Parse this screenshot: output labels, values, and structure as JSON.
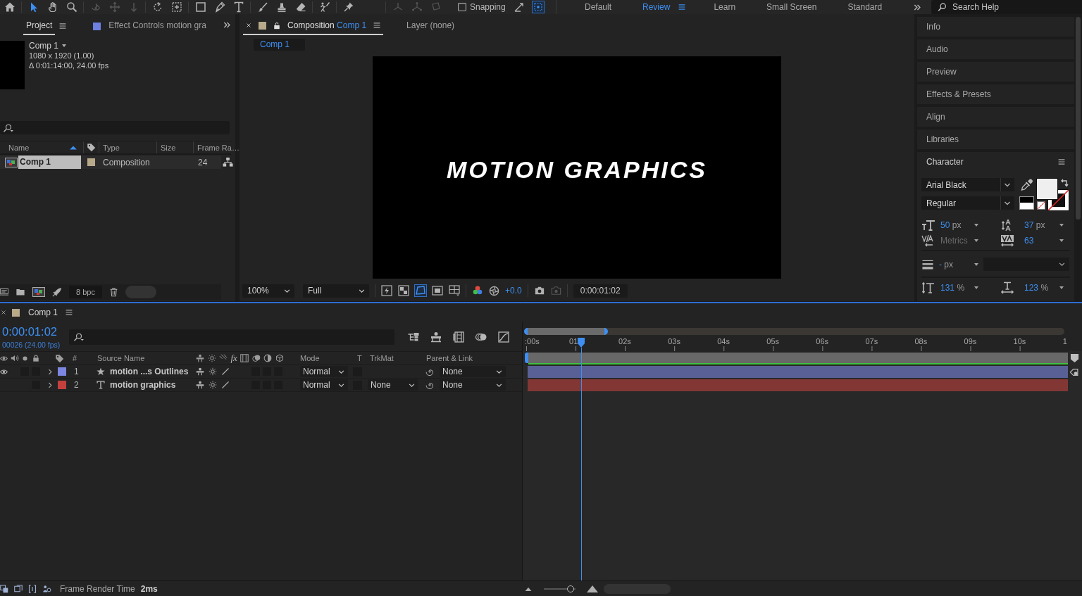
{
  "toolbar": {
    "tools": [
      {
        "selected": true,
        "disabled": false
      },
      {
        "selected": false,
        "disabled": false
      },
      {
        "selected": false,
        "disabled": false
      },
      {
        "selected": false,
        "disabled": true
      },
      {
        "selected": false,
        "disabled": true
      },
      {
        "selected": false,
        "disabled": true
      },
      {
        "selected": false,
        "disabled": false
      },
      {
        "selected": false,
        "disabled": false
      },
      {
        "selected": false,
        "disabled": false
      },
      {
        "selected": false,
        "disabled": false
      },
      {
        "selected": false,
        "disabled": false
      },
      {
        "selected": false,
        "disabled": false
      },
      {
        "selected": false,
        "disabled": false
      },
      {
        "selected": false,
        "disabled": false
      },
      {
        "selected": false,
        "disabled": false
      },
      {
        "selected": false,
        "disabled": false
      }
    ],
    "axis_modes": [
      {
        "disabled": true
      },
      {
        "disabled": true
      },
      {
        "disabled": true
      }
    ],
    "snapping": {
      "label": "Snapping",
      "checked": false
    },
    "snap_options": [
      {
        "on": false
      },
      {
        "on": true
      }
    ],
    "workspaces": [
      {
        "label": "Default",
        "selected": false
      },
      {
        "label": "Review",
        "selected": true
      },
      {
        "label": "Learn",
        "selected": false
      },
      {
        "label": "Small Screen",
        "selected": false
      },
      {
        "label": "Standard",
        "selected": false
      }
    ],
    "search": {
      "placeholder": "Search Help"
    }
  },
  "project_panel": {
    "tabs": [
      {
        "label": "Project",
        "selected": true
      },
      {
        "label": "Effect Controls motion gra",
        "selected": false,
        "color": "#6e80e0"
      }
    ],
    "preview": {
      "name": "Comp 1",
      "details": [
        "1080 x 1920 (1.00)",
        "Δ 0:01:14:00, 24.00 fps"
      ]
    },
    "columns": [
      "Name",
      "Type",
      "Size",
      "Frame Ra…"
    ],
    "items": [
      {
        "name": "Comp 1",
        "type": "Composition",
        "frame_rate": "24",
        "selected": true,
        "color": "#b7a98a"
      }
    ],
    "bit_depth": "8 bpc"
  },
  "composition_panel": {
    "tabs": [
      {
        "label": "Composition",
        "target": "Comp 1",
        "selected": true,
        "color": "#b7a98a"
      },
      {
        "label": "Layer (none)",
        "selected": false
      }
    ],
    "breadcrumb": "Comp 1",
    "viewer_text": "MOTION GRAPHICS",
    "zoom": "100%",
    "resolution": "Full",
    "view_toggles": [
      {
        "on": false
      },
      {
        "on": false
      },
      {
        "on": true
      },
      {
        "on": false
      },
      {
        "on": false
      }
    ],
    "exposure": "+0.0",
    "timecode": "0:00:01:02"
  },
  "side_panels": [
    {
      "title": "Info"
    },
    {
      "title": "Audio"
    },
    {
      "title": "Preview"
    },
    {
      "title": "Effects & Presets"
    },
    {
      "title": "Align"
    },
    {
      "title": "Libraries"
    }
  ],
  "character": {
    "title": "Character",
    "font": "Arial Black",
    "style": "Regular",
    "metrics": [
      {
        "kind": "number",
        "value": "50",
        "unit": "px"
      },
      {
        "kind": "number",
        "value": "37",
        "unit": "px"
      },
      {
        "kind": "option",
        "value": "Metrics"
      },
      {
        "kind": "number",
        "value": "63"
      }
    ],
    "stroke_width": {
      "value": "-",
      "unit": "px"
    },
    "scales": [
      {
        "value": "131",
        "unit": "%"
      },
      {
        "value": "123",
        "unit": "%"
      }
    ]
  },
  "timeline": {
    "tab": {
      "label": "Comp 1",
      "color": "#b7a98a"
    },
    "timecode": "0:00:01:02",
    "frame_info": "00026 (24.00 fps)",
    "columns": {
      "number": "#",
      "source_name": "Source Name",
      "effects": "fx",
      "mode": "Mode",
      "track_matte_toggle": "T",
      "track_matte": "TrkMat",
      "parent": "Parent & Link"
    },
    "layers": [
      {
        "number": "1",
        "kind": "shape",
        "name": "motion ...s Outlines",
        "color": "#7b87e2",
        "visible": true,
        "mode": "Normal",
        "parent": "None"
      },
      {
        "number": "2",
        "kind": "text",
        "name": "motion graphics",
        "color": "#c4403d",
        "visible": false,
        "mode": "Normal",
        "track_matte": "None",
        "parent": "None"
      }
    ],
    "navigator": {
      "level": 0.155
    },
    "ruler": [
      ":00s",
      "01",
      "02s",
      "03s",
      "04s",
      "05s",
      "06s",
      "07s",
      "08s",
      "09s",
      "10s",
      "1"
    ],
    "playhead": {
      "level": 0.104
    }
  },
  "status_bar": {
    "label": "Frame Render Time",
    "value": "2ms",
    "zoom": {
      "level": 0.85
    }
  }
}
